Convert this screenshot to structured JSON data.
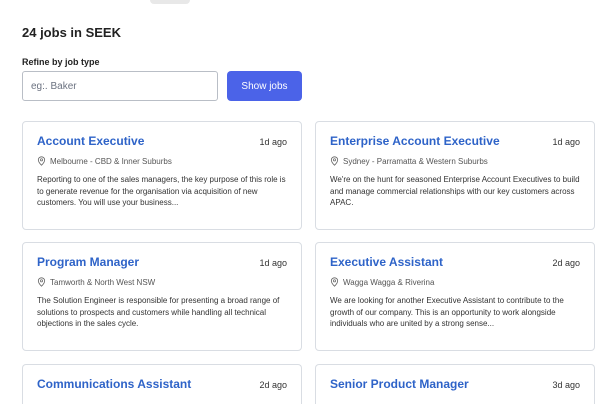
{
  "header": {
    "title": "24 jobs in SEEK"
  },
  "filter": {
    "label": "Refine by job type",
    "placeholder": "eg:. Baker",
    "button_label": "Show jobs"
  },
  "colors": {
    "accent": "#4b63e8",
    "link": "#2e63c8"
  },
  "jobs": [
    {
      "title": "Account Executive",
      "date": "1d ago",
      "location": "Melbourne - CBD & Inner Suburbs",
      "description": "Reporting to one of the sales managers, the key purpose of this role is to generate revenue for the organisation via acquisition of new customers. You will use your business..."
    },
    {
      "title": "Enterprise Account Executive",
      "date": "1d ago",
      "location": "Sydney - Parramatta & Western Suburbs",
      "description": "We're on the hunt for seasoned Enterprise Account Executives to build and manage commercial relationships with our key customers across APAC."
    },
    {
      "title": "Program Manager",
      "date": "1d ago",
      "location": "Tamworth & North West NSW",
      "description": "The Solution Engineer is responsible for presenting a broad range of solutions to prospects and customers while handling all technical objections in the sales cycle."
    },
    {
      "title": "Executive Assistant",
      "date": "2d ago",
      "location": "Wagga Wagga & Riverina",
      "description": "We are looking for another Executive Assistant to contribute to the growth of our company. This is an opportunity to work alongside individuals who are united by a strong sense..."
    },
    {
      "title": "Communications Assistant",
      "date": "2d ago"
    },
    {
      "title": "Senior Product Manager",
      "date": "3d ago"
    }
  ]
}
